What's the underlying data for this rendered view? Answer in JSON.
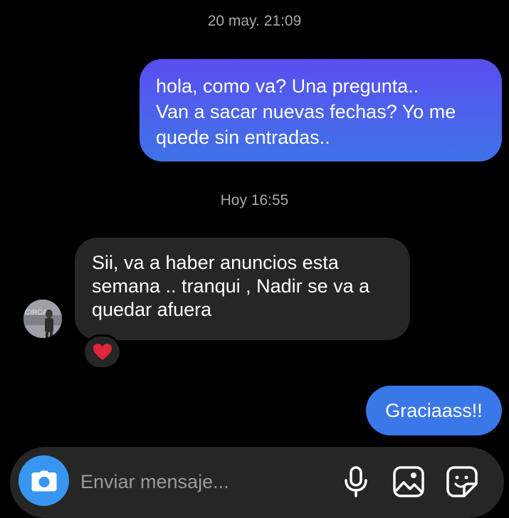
{
  "conversation": {
    "timestamps": [
      "20 may. 21:09",
      "Hoy 16:55"
    ],
    "messages": [
      {
        "direction": "outgoing",
        "lines": [
          "hola, como va? Una pregunta..",
          "Van a sacar nuevas fechas? Yo me",
          "quede sin entradas.."
        ]
      },
      {
        "direction": "incoming",
        "lines": [
          "Sii, va a haber anuncios esta",
          "semana .. tranqui , Nadir se va a",
          "quedar afuera"
        ],
        "reaction": "heart"
      },
      {
        "direction": "outgoing",
        "text": "Graciaass!!"
      }
    ],
    "avatar": {
      "icon": "contact-avatar",
      "logo_text": "CIRCA"
    }
  },
  "composer": {
    "placeholder": "Enviar mensaje...",
    "value": "",
    "icons": [
      "camera-icon",
      "microphone-icon",
      "gallery-icon",
      "sticker-icon"
    ]
  },
  "colors": {
    "background": "#000000",
    "incoming_bubble": "#262626",
    "outgoing_bubble_gradient": [
      "#5a4ef0",
      "#3f72e6"
    ],
    "outgoing_bubble_solid": "#3b78e7",
    "camera_button": "#3896f0",
    "timestamp_text": "#a8a8a8",
    "heart": "#e0253d"
  }
}
